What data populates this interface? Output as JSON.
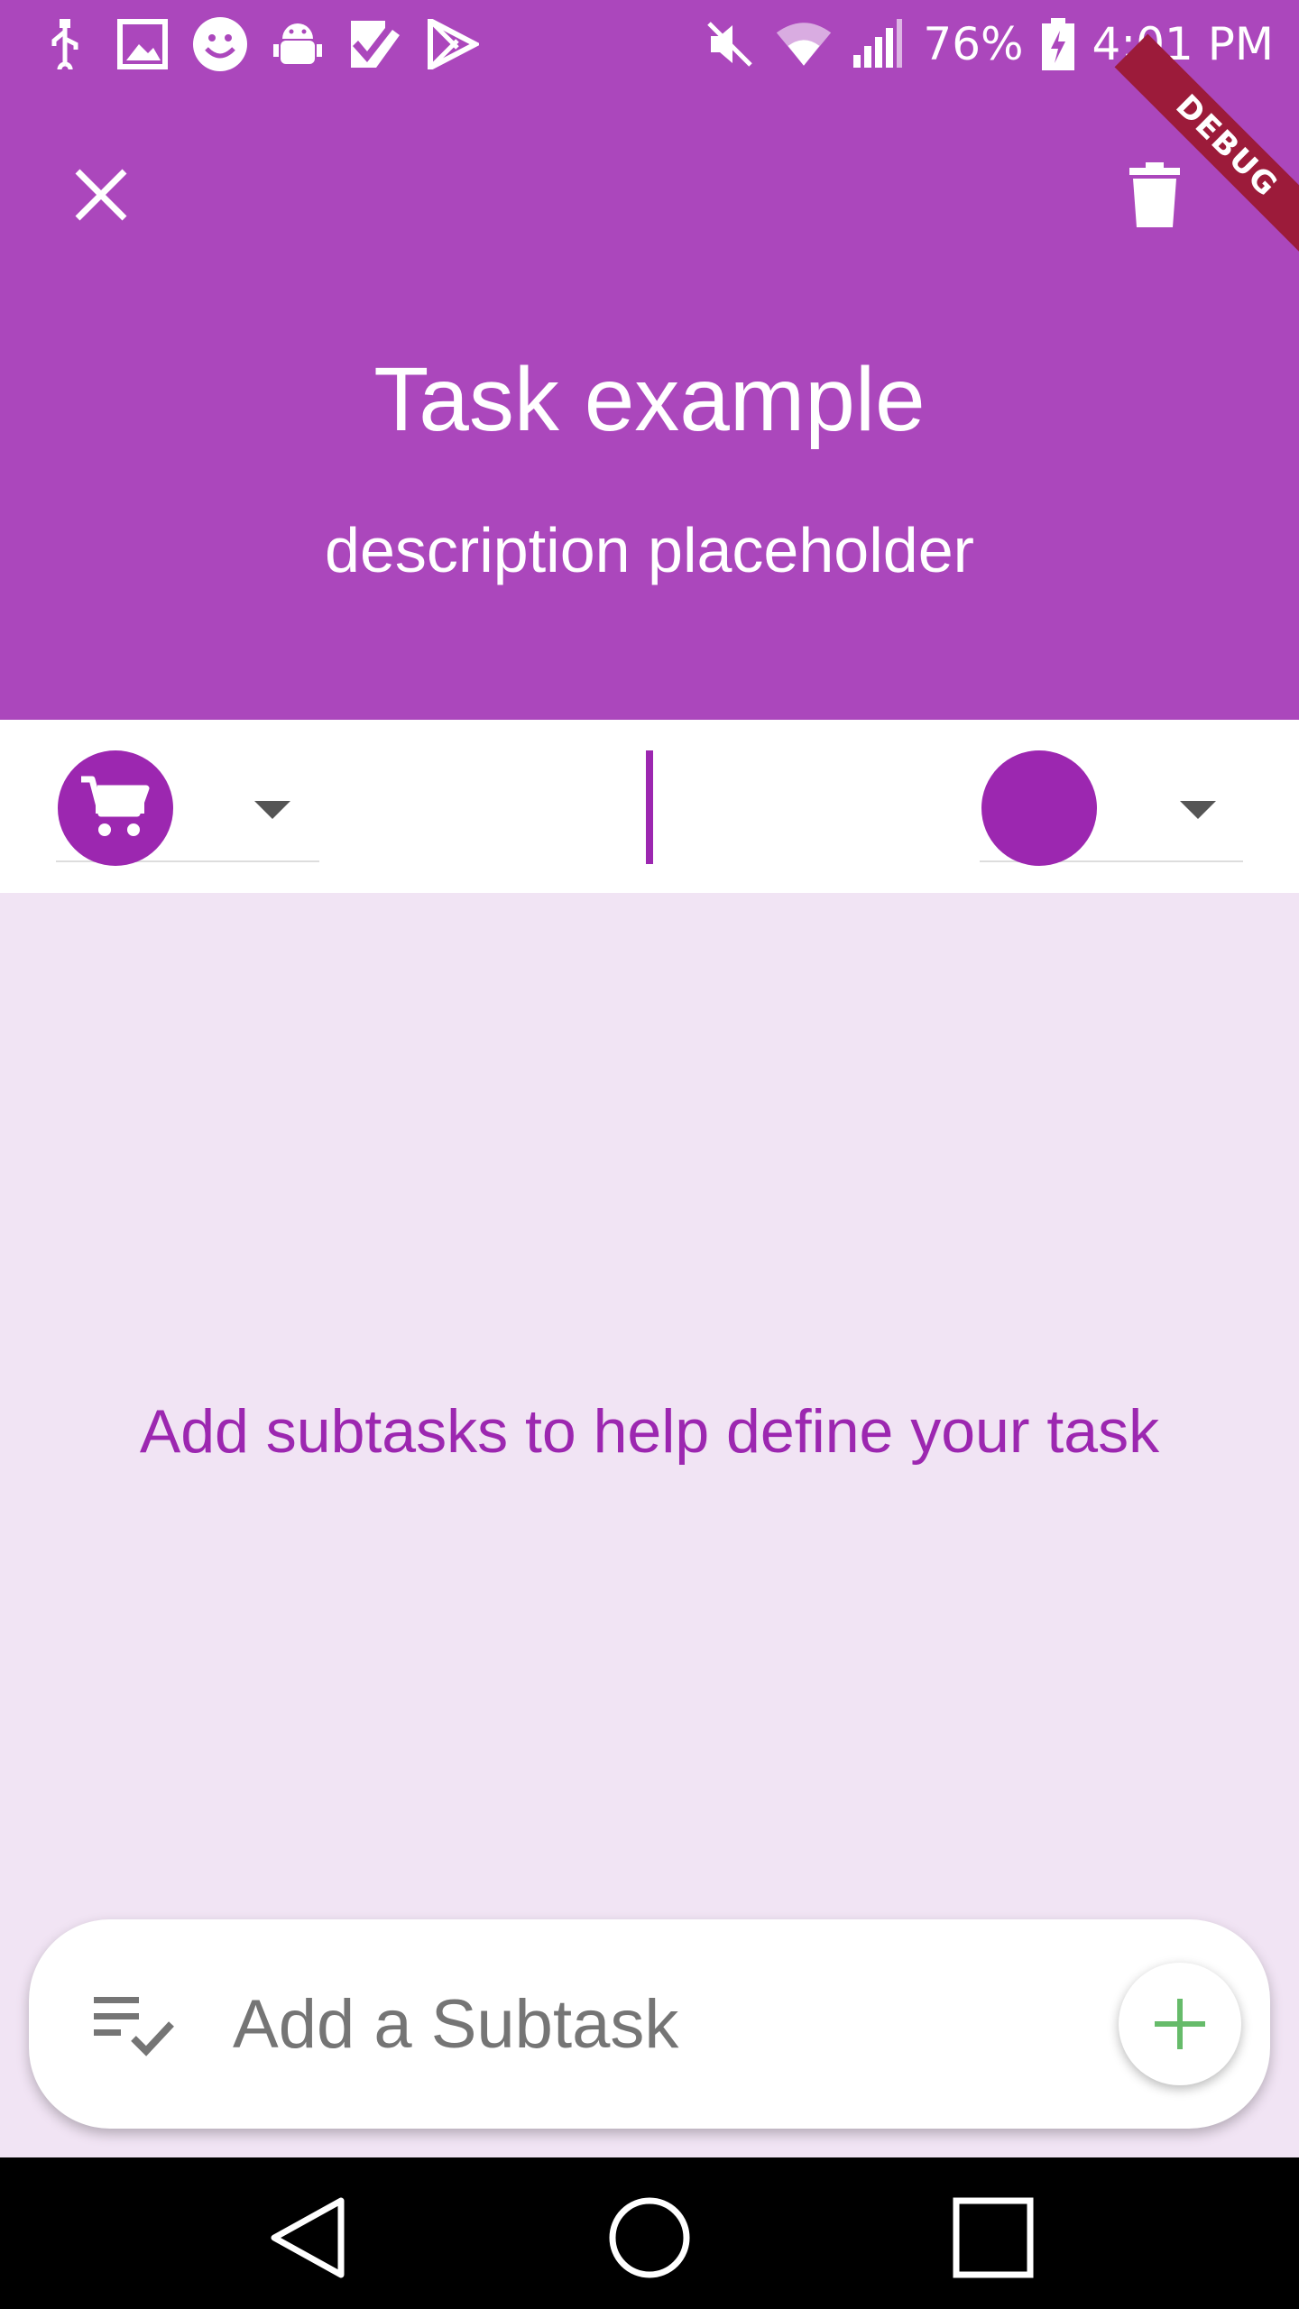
{
  "status_bar": {
    "battery": "76%",
    "time": "4:01 PM",
    "icons": [
      "usb-icon",
      "image-icon",
      "smiley-icon",
      "android-debug-icon",
      "check-app-icon",
      "play-store-icon",
      "mute-icon",
      "wifi-icon",
      "signal-icon",
      "battery-charging-icon"
    ]
  },
  "header": {
    "close_icon": "close-icon",
    "delete_icon": "trash-icon",
    "debug_banner": "DEBUG",
    "title": "Task example",
    "description": "description placeholder"
  },
  "selectors": {
    "icon_selected": "cart-icon",
    "color_selected": "#9c27b0"
  },
  "main": {
    "empty_message": "Add subtasks to help define your task"
  },
  "subtask_bar": {
    "placeholder": "Add a Subtask",
    "value": "",
    "add_icon": "plus-icon"
  },
  "colors": {
    "primary": "#ab47bc",
    "accent": "#9c27b0",
    "background": "#f1e4f4",
    "add_plus": "#66bb6a"
  }
}
